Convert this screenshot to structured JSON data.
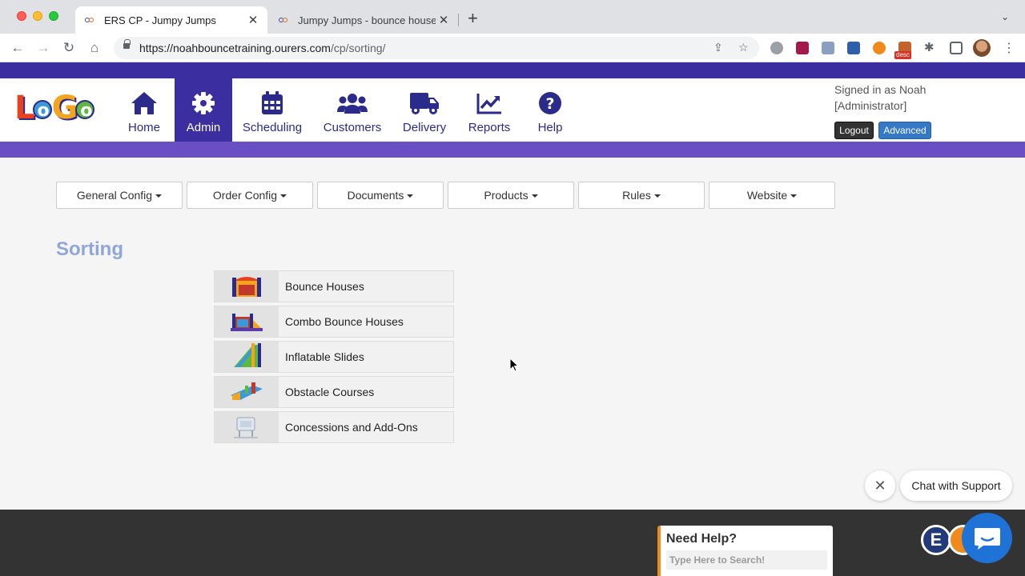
{
  "browser": {
    "tabs": [
      {
        "title": "ERS CP - Jumpy Jumps",
        "active": true
      },
      {
        "title": "Jumpy Jumps - bounce house",
        "active": false
      }
    ],
    "url_host": "https://noahbouncetraining.ourers.com",
    "url_path": "/cp/sorting/",
    "ext_badge": "desc"
  },
  "header": {
    "logo_text": [
      "L",
      "o",
      "G",
      "o"
    ],
    "nav": [
      {
        "label": "Home",
        "icon": "home-icon"
      },
      {
        "label": "Admin",
        "icon": "gear-icon",
        "active": true
      },
      {
        "label": "Scheduling",
        "icon": "calendar-icon"
      },
      {
        "label": "Customers",
        "icon": "users-icon"
      },
      {
        "label": "Delivery",
        "icon": "truck-icon"
      },
      {
        "label": "Reports",
        "icon": "chart-line-icon"
      },
      {
        "label": "Help",
        "icon": "question-icon"
      }
    ],
    "signed_in_line1": "Signed in as Noah",
    "signed_in_line2": "[Administrator]",
    "logout_label": "Logout",
    "advanced_label": "Advanced"
  },
  "config_menus": [
    "General Config",
    "Order Config",
    "Documents",
    "Products",
    "Rules",
    "Website"
  ],
  "page_title": "Sorting",
  "categories": [
    {
      "name": "Bounce Houses"
    },
    {
      "name": "Combo Bounce Houses"
    },
    {
      "name": "Inflatable Slides"
    },
    {
      "name": "Obstacle Courses"
    },
    {
      "name": "Concessions and Add-Ons"
    }
  ],
  "chat": {
    "close_symbol": "✕",
    "label": "Chat with Support",
    "badge_letter": "E"
  },
  "help_widget": {
    "title": "Need Help?",
    "placeholder": "Type Here to Search!"
  },
  "colors": {
    "brand_dark": "#3b2ea0",
    "brand_light": "#6a4fc4",
    "nav_text": "#2b2b8c",
    "title": "#8ea6d8",
    "chat_blue": "#1f73d6",
    "help_accent": "#f08a1c"
  }
}
